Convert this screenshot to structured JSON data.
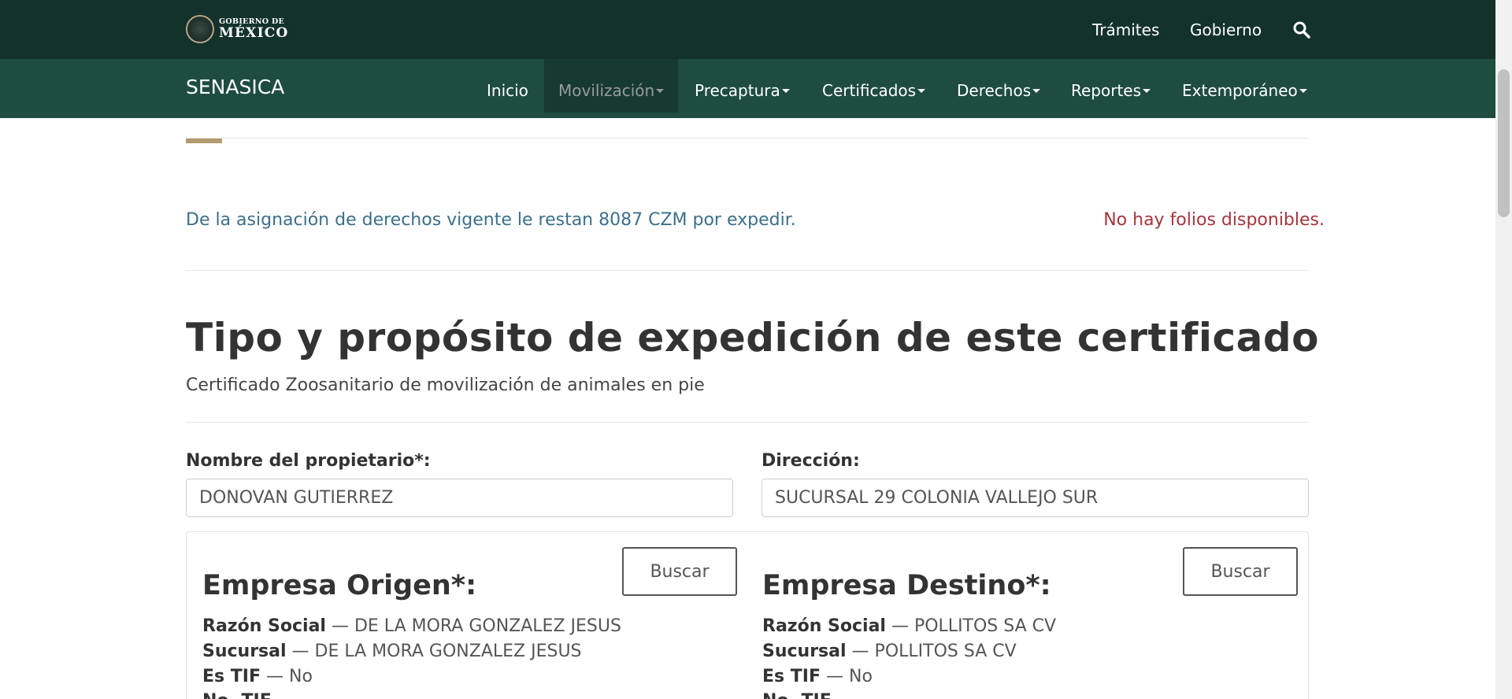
{
  "header": {
    "logo_small": "GOBIERNO DE",
    "logo_big": "MÉXICO",
    "links": [
      "Trámites",
      "Gobierno"
    ],
    "search_icon": "search-icon"
  },
  "navbar": {
    "brand": "SENASICA",
    "items": [
      {
        "label": "Inicio",
        "dropdown": false,
        "active": false
      },
      {
        "label": "Movilización",
        "dropdown": true,
        "active": true
      },
      {
        "label": "Precaptura",
        "dropdown": true,
        "active": false
      },
      {
        "label": "Certificados",
        "dropdown": true,
        "active": false
      },
      {
        "label": "Derechos",
        "dropdown": true,
        "active": false
      },
      {
        "label": "Reportes",
        "dropdown": true,
        "active": false
      },
      {
        "label": "Extemporáneo",
        "dropdown": true,
        "active": false
      }
    ]
  },
  "notices": {
    "remaining": "De la asignación de derechos vigente le restan 8087 CZM por expedir.",
    "folios": "No hay folios disponibles."
  },
  "main": {
    "title": "Tipo y propósito de expedición de este certificado",
    "subtitle": "Certificado Zoosanitario de movilización de animales en pie"
  },
  "form": {
    "owner_label": "Nombre del propietario*:",
    "owner_value": "DONOVAN GUTIERREZ",
    "address_label": "Dirección:",
    "address_value": "SUCURSAL 29 COLONIA VALLEJO SUR"
  },
  "origin": {
    "title": "Empresa Origen*:",
    "button": "Buscar",
    "razon_label": "Razón Social",
    "razon_value": "DE LA MORA GONZALEZ JESUS",
    "sucursal_label": "Sucursal",
    "sucursal_value": "DE LA MORA GONZALEZ JESUS",
    "tif_label": "Es TIF",
    "tif_value": "No",
    "no_tif_label": "No. TIF"
  },
  "destination": {
    "title": "Empresa Destino*:",
    "button": "Buscar",
    "razon_label": "Razón Social",
    "razon_value": "POLLITOS SA CV",
    "sucursal_label": "Sucursal",
    "sucursal_value": "POLLITOS SA CV",
    "tif_label": "Es TIF",
    "tif_value": "No",
    "no_tif_label": "No. TIF"
  },
  "separator": " — ",
  "colors": {
    "topbar": "#13322b",
    "navbar": "#1e4c40",
    "accent": "#b39b71",
    "info_text": "#3c6f8b",
    "error_text": "#a5363c"
  }
}
